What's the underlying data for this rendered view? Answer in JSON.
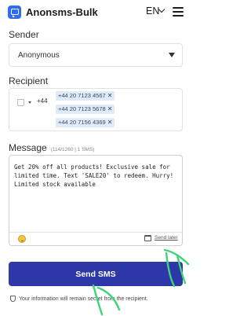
{
  "header": {
    "brand": "Anonsms-Bulk",
    "language": "EN",
    "icons": {
      "logo": "chat-bubble-icon",
      "language_chevron": "chevron-down-icon",
      "menu": "hamburger-menu-icon"
    },
    "accent_color": "#2f6df0"
  },
  "sender": {
    "label": "Sender",
    "value": "Anonymous"
  },
  "recipient": {
    "label": "Recipient",
    "country_code": "+44",
    "numbers": [
      "+44 20 7123 4567",
      "+44 20 7123 5678",
      "+44 20 7156 4369"
    ],
    "remove_glyph": "✕",
    "chip_color": "#dfecf8"
  },
  "message": {
    "label": "Message",
    "counter": "(114/1260 | 1 SMS)",
    "text": "Get 20% off all products! Exclusive sale for limited time. Text 'SALE20' to redeem. Hurry! Limited stock available",
    "send_later": "Send later"
  },
  "send_button": {
    "label": "Send SMS",
    "color": "#2d37a8"
  },
  "info": {
    "text": "Your information will remain secret from the recipient.",
    "icon": "shield-icon"
  }
}
